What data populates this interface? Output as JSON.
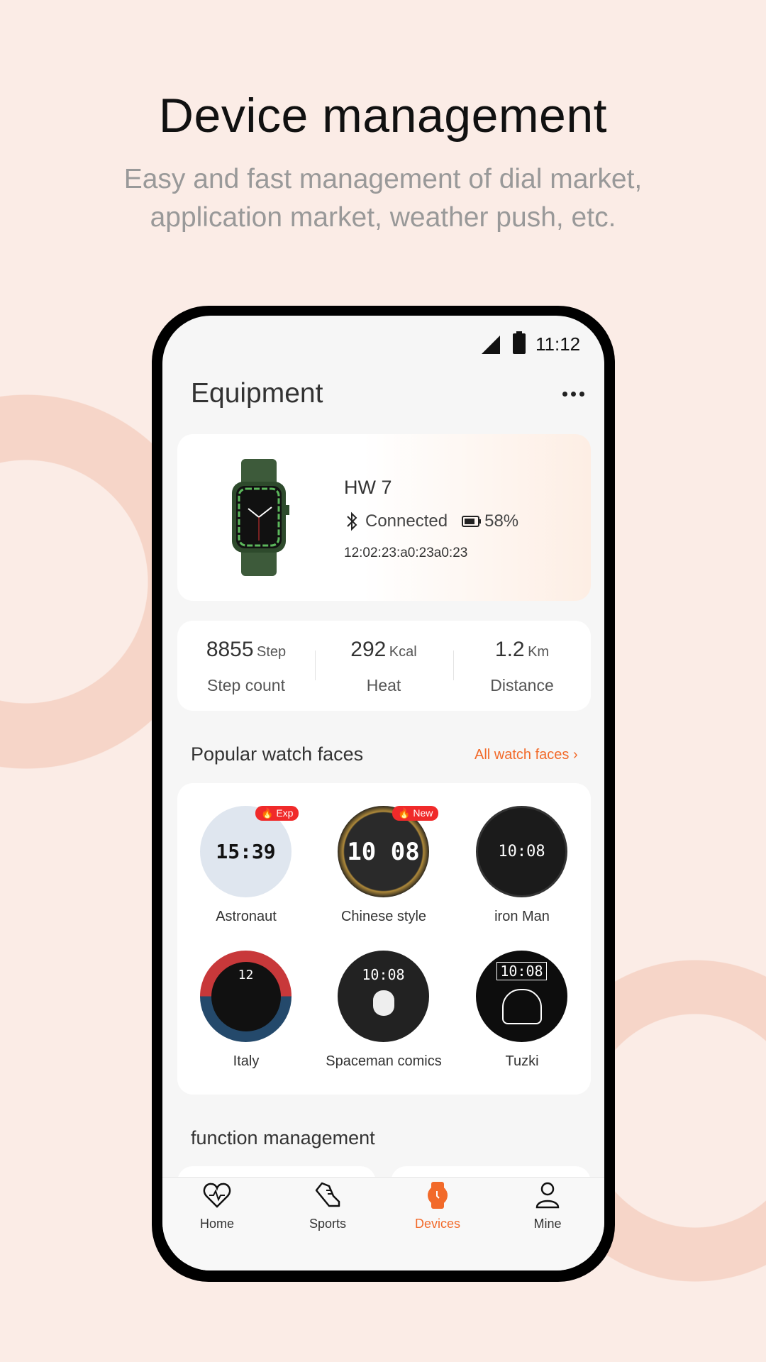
{
  "headline": {
    "title": "Device management",
    "subtitle_line1": "Easy and fast management of dial market,",
    "subtitle_line2": "application market, weather push, etc."
  },
  "status_bar": {
    "time": "11:12",
    "icons": [
      "signal-icon",
      "battery-icon"
    ]
  },
  "header": {
    "title": "Equipment",
    "more_icon": "more-dots-icon"
  },
  "device": {
    "name": "HW 7",
    "connection": "Connected",
    "battery": "58%",
    "mac": "12:02:23:a0:23a0:23"
  },
  "stats": [
    {
      "value": "8855",
      "unit": "Step",
      "label": "Step count"
    },
    {
      "value": "292",
      "unit": "Kcal",
      "label": "Heat"
    },
    {
      "value": "1.2",
      "unit": "Km",
      "label": "Distance"
    }
  ],
  "watch_faces": {
    "title": "Popular watch faces",
    "all_link": "All watch faces",
    "items": [
      {
        "name": "Astronaut",
        "badge": "Exp",
        "time": "15:39"
      },
      {
        "name": "Chinese style",
        "badge": "New",
        "time": "10 08"
      },
      {
        "name": "iron Man",
        "time": "10:08"
      },
      {
        "name": "Italy",
        "time": "12"
      },
      {
        "name": "Spaceman comics",
        "time": "10:08"
      },
      {
        "name": "Tuzki",
        "time": "10:08"
      }
    ]
  },
  "function_management": {
    "title": "function management"
  },
  "nav": [
    {
      "label": "Home",
      "icon": "heart-pulse-icon"
    },
    {
      "label": "Sports",
      "icon": "shoe-icon"
    },
    {
      "label": "Devices",
      "icon": "watch-icon",
      "active": true
    },
    {
      "label": "Mine",
      "icon": "person-icon"
    }
  ],
  "colors": {
    "accent": "#f26a2a",
    "background": "#fbece6",
    "badge": "#f02a2a"
  }
}
